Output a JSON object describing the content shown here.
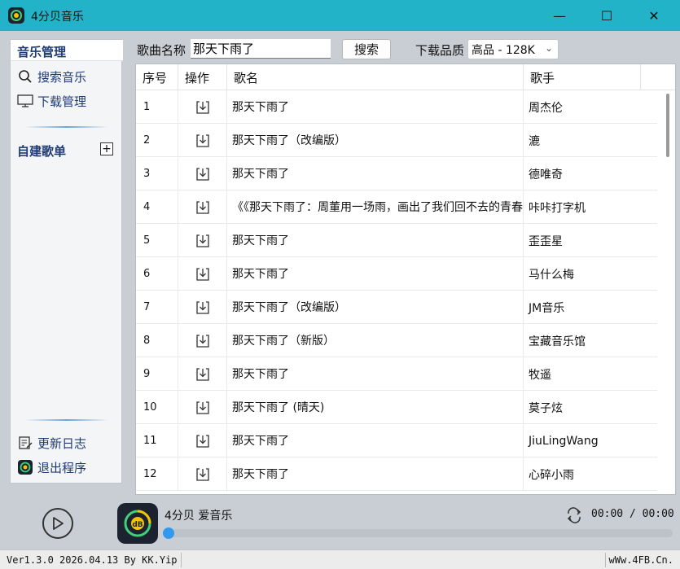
{
  "window": {
    "title": "4分贝音乐",
    "minimize_label": "—",
    "maximize_label": "☐",
    "close_label": "✕"
  },
  "sidebar": {
    "header": "音乐管理",
    "items": [
      {
        "label": "搜索音乐",
        "icon": "search-icon"
      },
      {
        "label": "下载管理",
        "icon": "monitor-icon"
      }
    ],
    "playlist_label": "自建歌单",
    "add_label": "+",
    "bottom_items": [
      {
        "label": "更新日志",
        "icon": "log-icon"
      },
      {
        "label": "退出程序",
        "icon": "app-logo-icon"
      }
    ]
  },
  "search": {
    "label": "歌曲名称",
    "value": "那天下雨了",
    "button": "搜索",
    "quality_label": "下载品质",
    "quality_value": "高品 - 128K"
  },
  "table": {
    "columns": [
      "序号",
      "操作",
      "歌名",
      "歌手"
    ],
    "rows": [
      {
        "no": "1",
        "name": "那天下雨了",
        "artist": "周杰伦"
      },
      {
        "no": "2",
        "name": "那天下雨了（改编版）",
        "artist": "漉"
      },
      {
        "no": "3",
        "name": "那天下雨了",
        "artist": "德唯奇"
      },
      {
        "no": "4",
        "name": "《《那天下雨了：周董用一场雨，画出了我们回不去的青春",
        "artist": "咔咔打字机"
      },
      {
        "no": "5",
        "name": "那天下雨了",
        "artist": "歪歪星"
      },
      {
        "no": "6",
        "name": "那天下雨了",
        "artist": "马什么梅"
      },
      {
        "no": "7",
        "name": "那天下雨了（改编版）",
        "artist": "JM音乐"
      },
      {
        "no": "8",
        "name": "那天下雨了（新版）",
        "artist": "宝藏音乐馆"
      },
      {
        "no": "9",
        "name": "那天下雨了",
        "artist": "牧遥"
      },
      {
        "no": "10",
        "name": "那天下雨了 (晴天)",
        "artist": "莫子炫"
      },
      {
        "no": "11",
        "name": "那天下雨了",
        "artist": "JiuLingWang"
      },
      {
        "no": "12",
        "name": "那天下雨了",
        "artist": "心碎小雨"
      }
    ]
  },
  "player": {
    "track": "4分贝  爱音乐",
    "time": "00:00 / 00:00",
    "progress": 0
  },
  "status": {
    "version": "Ver1.3.0 2026.04.13 By KK.Yip",
    "site": "wWw.4FB.Cn."
  },
  "colors": {
    "titlebar": "#23b3c8",
    "frame": "#c8ced4",
    "sidebar_text": "#1f3b74",
    "progress_knob": "#3399ee"
  }
}
